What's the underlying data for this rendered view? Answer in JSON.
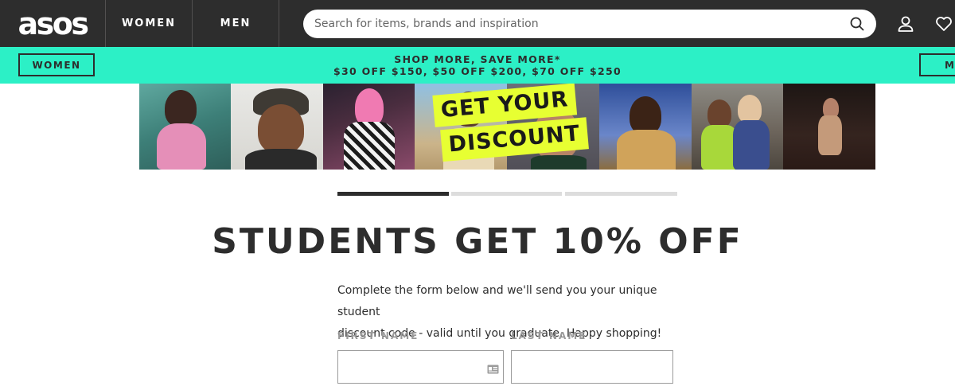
{
  "header": {
    "logo": "asos",
    "nav": [
      {
        "label": "WOMEN"
      },
      {
        "label": "MEN"
      }
    ],
    "search": {
      "placeholder": "Search for items, brands and inspiration",
      "value": ""
    },
    "icons": [
      "search-icon",
      "account-icon",
      "heart-icon"
    ]
  },
  "promo": {
    "left_button": "WOMEN",
    "right_button": "MEN",
    "line1": "SHOP MORE, SAVE MORE*",
    "line2": "$30 OFF $150, $50 OFF $200, $70 OFF $250"
  },
  "banner": {
    "badge_line1": "GET YOUR",
    "badge_line2": "DISCOUNT"
  },
  "progress": {
    "steps": 3,
    "current_step": 1
  },
  "form": {
    "title": "STUDENTS GET 10% OFF",
    "intro_line1": "Complete the form below and we'll send you your unique student",
    "intro_line2": "discount code - valid until you graduate. Happy shopping!",
    "first_name_label": "FIRST NAME",
    "last_name_label": "LAST NAME",
    "first_name_value": "",
    "last_name_value": ""
  },
  "colors": {
    "nav_bg": "#2d2d2d",
    "promo_bg": "#2cf0c6",
    "badge_bg": "#e7ff32",
    "progress_active": "#2d2d2d",
    "progress_inactive": "#dddddd",
    "label_grey": "#9b9b9b"
  }
}
